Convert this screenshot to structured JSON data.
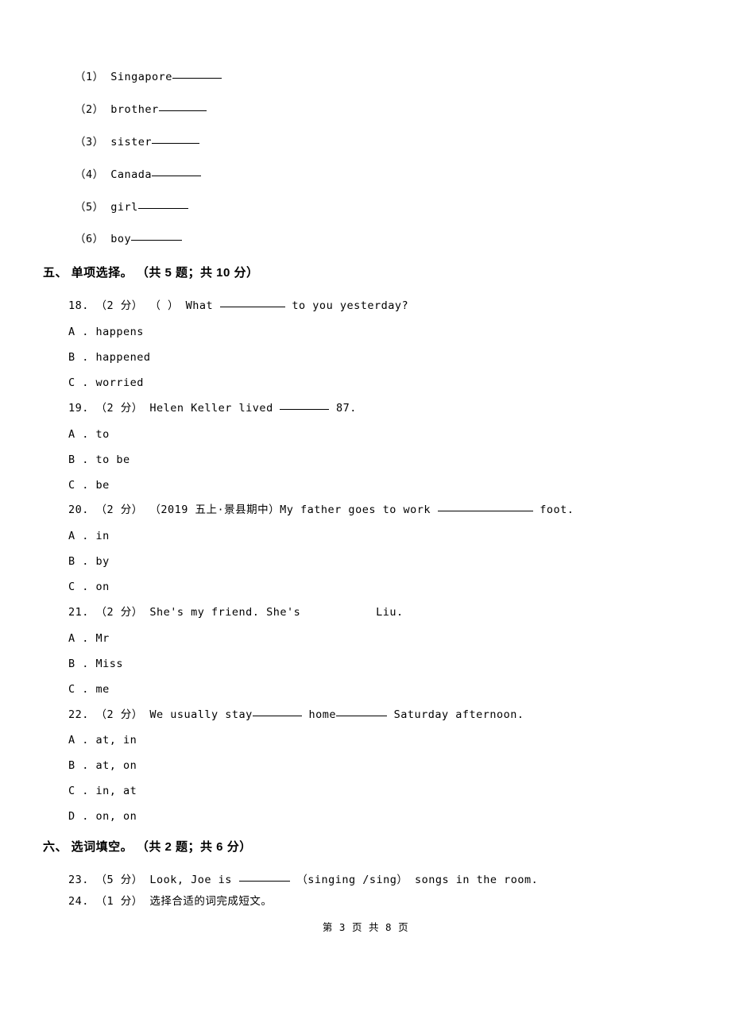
{
  "vocab_items": [
    {
      "num": "（1）",
      "word": "Singapore",
      "blank_w": 62
    },
    {
      "num": "（2）",
      "word": "brother",
      "blank_w": 60
    },
    {
      "num": "（3）",
      "word": "sister",
      "blank_w": 60
    },
    {
      "num": "（4）",
      "word": "Canada",
      "blank_w": 62
    },
    {
      "num": "（5）",
      "word": "girl",
      "blank_w": 63
    },
    {
      "num": "（6）",
      "word": "boy",
      "blank_w": 64
    }
  ],
  "section5_header": "五、 单项选择。 （共 5 题；共 10 分）",
  "q18": {
    "prefix": "18. （2 分） （   ） What ",
    "suffix": " to you yesterday?",
    "blank_w": 82,
    "options": {
      "A": "A . happens",
      "B": "B . happened",
      "C": "C . worried"
    }
  },
  "q19": {
    "prefix": "19. （2 分） Helen Keller lived ",
    "suffix": " 87.",
    "blank_w": 62,
    "options": {
      "A": "A . to",
      "B": "B . to be",
      "C": "C . be"
    }
  },
  "q20": {
    "prefix": "20. （2 分） （2019 五上·景县期中）My father goes to work ",
    "suffix": " foot.",
    "blank_w": 120,
    "options": {
      "A": "A . in",
      "B": "B . by",
      "C": "C . on"
    }
  },
  "q21": {
    "text": "21. （2 分） She's my friend. She's           Liu.",
    "options": {
      "A": "A . Mr",
      "B": "B . Miss",
      "C": "C . me"
    }
  },
  "q22": {
    "prefix": "22. （2 分） We usually stay",
    "mid": " home",
    "suffix": " Saturday afternoon.",
    "blank1_w": 62,
    "blank2_w": 64,
    "options": {
      "A": "A . at, in",
      "B": "B . at, on",
      "C": "C . in, at",
      "D": "D . on, on"
    }
  },
  "section6_header": "六、 选词填空。 （共 2 题；共 6 分）",
  "q23": {
    "prefix": "23. （5 分） Look, Joe is ",
    "suffix": " （singing /sing） songs in the room.",
    "blank_w": 64
  },
  "q24": {
    "text": "24. （1 分） 选择合适的词完成短文。"
  },
  "footer": "第 3 页 共 8 页"
}
